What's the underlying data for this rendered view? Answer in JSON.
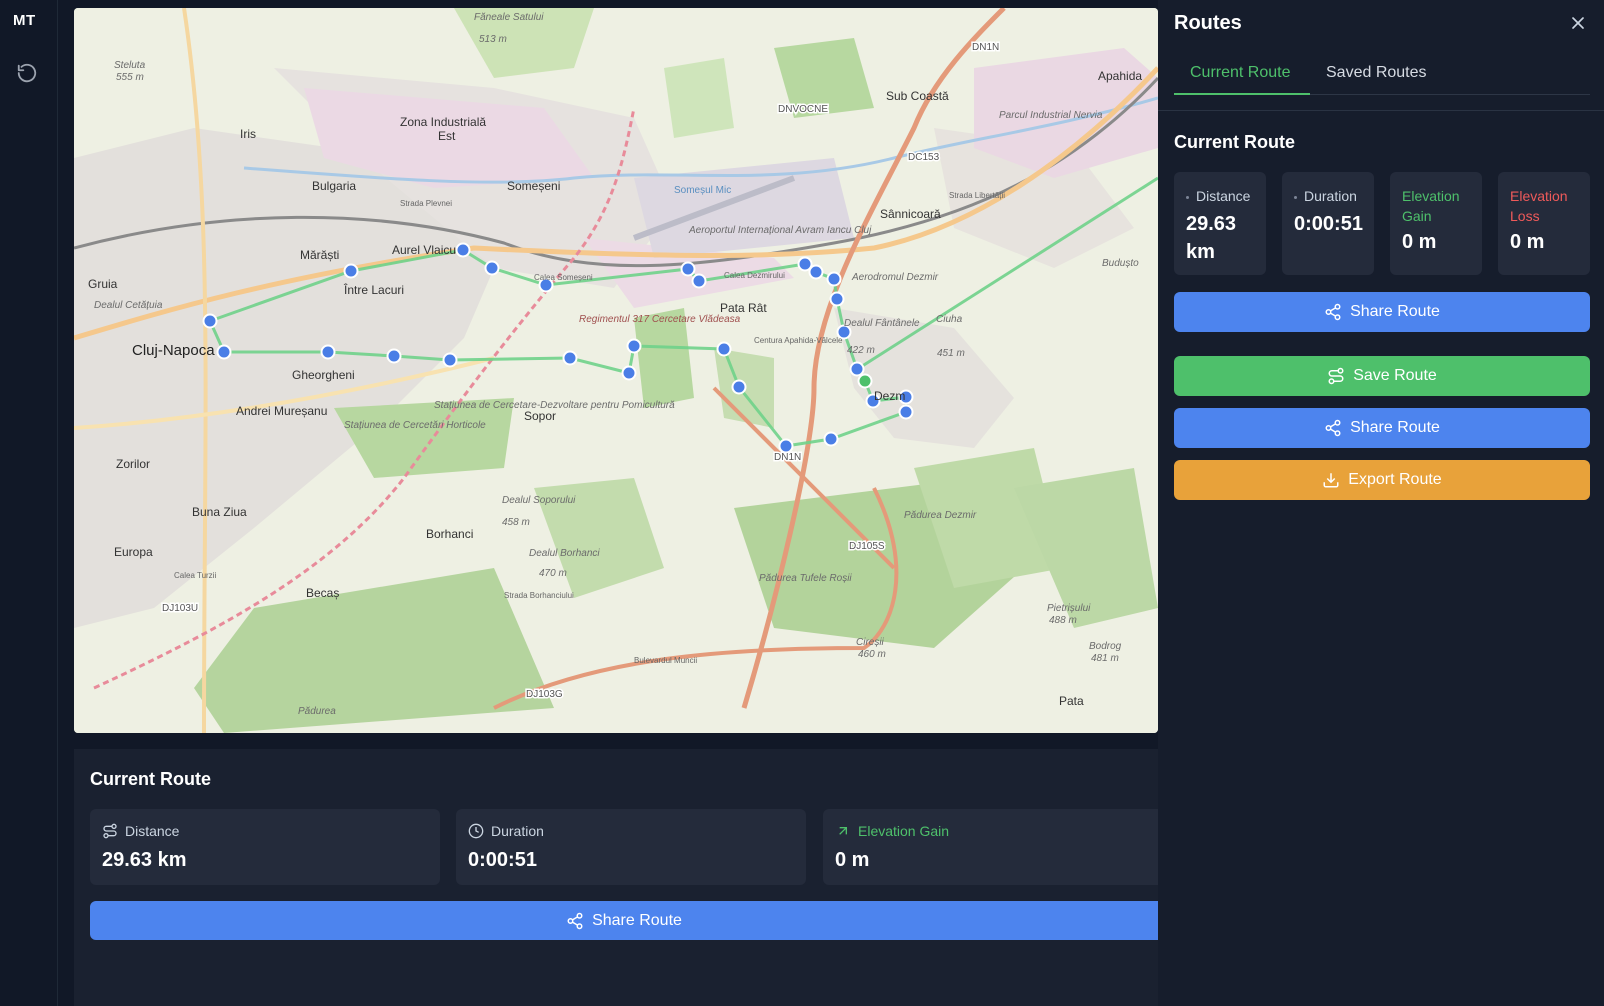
{
  "app": {
    "logo": "MT"
  },
  "icons": {
    "reset": "rotate-ccw-icon",
    "close": "close-icon",
    "share": "share-icon",
    "save": "route-icon",
    "export": "download-icon",
    "distance": "route-icon",
    "duration": "clock-icon",
    "elevation_gain": "trending-up-icon"
  },
  "colors": {
    "accent_green": "#4ec06b",
    "share_blue": "#4d84ee",
    "save_green": "#4ec06b",
    "export_orange": "#e8a23a",
    "loss_red": "#ef5a5a",
    "route_line": "#6fd18a",
    "waypoint": "#4a7ee6"
  },
  "map": {
    "labels": [
      {
        "text": "Făneale Satului",
        "kind": "small"
      },
      {
        "text": "513 m",
        "kind": "small"
      },
      {
        "text": "Steluta",
        "kind": "small"
      },
      {
        "text": "555 m",
        "kind": "small"
      },
      {
        "text": "Zona Industrială",
        "kind": "place"
      },
      {
        "text": "Est",
        "kind": "place"
      },
      {
        "text": "DNVOCNE",
        "kind": "road"
      },
      {
        "text": "Sub Coastă",
        "kind": "place"
      },
      {
        "text": "Parcul Industrial Nervia",
        "kind": "small"
      },
      {
        "text": "DN1N",
        "kind": "road"
      },
      {
        "text": "Apahida",
        "kind": "place"
      },
      {
        "text": "Iris",
        "kind": "place"
      },
      {
        "text": "Bulgaria",
        "kind": "place"
      },
      {
        "text": "Someșeni",
        "kind": "place"
      },
      {
        "text": "Aeroportul Internațional Avram Iancu Cluj",
        "kind": "small"
      },
      {
        "text": "DC153",
        "kind": "road"
      },
      {
        "text": "Sânnicoară",
        "kind": "place"
      },
      {
        "text": "Mărăști",
        "kind": "place"
      },
      {
        "text": "Aurel Vlaicu",
        "kind": "place"
      },
      {
        "text": "Gruia",
        "kind": "place"
      },
      {
        "text": "Între Lacuri",
        "kind": "place"
      },
      {
        "text": "Aerodromul Dezmir",
        "kind": "small"
      },
      {
        "text": "Budușto",
        "kind": "small"
      },
      {
        "text": "Pata Rât",
        "kind": "place"
      },
      {
        "text": "Cluj-Napoca",
        "kind": "city"
      },
      {
        "text": "Regimentul 317 Cercetare Vlădeasa",
        "kind": "military"
      },
      {
        "text": "Dealul Fântânele",
        "kind": "small"
      },
      {
        "text": "422 m",
        "kind": "small"
      },
      {
        "text": "Ciuha",
        "kind": "small"
      },
      {
        "text": "451 m",
        "kind": "small"
      },
      {
        "text": "Gheorgheni",
        "kind": "place"
      },
      {
        "text": "Dealul Cetățuia",
        "kind": "small"
      },
      {
        "text": "Dezm",
        "kind": "place"
      },
      {
        "text": "Andrei Mureșanu",
        "kind": "place"
      },
      {
        "text": "Sopor",
        "kind": "place"
      },
      {
        "text": "Stațiunea de Cercetări Horticole",
        "kind": "small"
      },
      {
        "text": "Stațiunea de Cercetare-Dezvoltare pentru Pomicultură",
        "kind": "small"
      },
      {
        "text": "Zorilor",
        "kind": "place"
      },
      {
        "text": "Dealul Soporului",
        "kind": "small"
      },
      {
        "text": "458 m",
        "kind": "small"
      },
      {
        "text": "Buna Ziua",
        "kind": "place"
      },
      {
        "text": "Borhanci",
        "kind": "place"
      },
      {
        "text": "Pădurea Dezmir",
        "kind": "small"
      },
      {
        "text": "DJ105S",
        "kind": "road"
      },
      {
        "text": "Europa",
        "kind": "place"
      },
      {
        "text": "Dealul Borhanci",
        "kind": "small"
      },
      {
        "text": "470 m",
        "kind": "small"
      },
      {
        "text": "Pădurea Tufele Roșii",
        "kind": "small"
      },
      {
        "text": "Becaș",
        "kind": "place"
      },
      {
        "text": "DJ103U",
        "kind": "road"
      },
      {
        "text": "Pietrișului",
        "kind": "small"
      },
      {
        "text": "488 m",
        "kind": "small"
      },
      {
        "text": "Cireșii",
        "kind": "small"
      },
      {
        "text": "460 m",
        "kind": "small"
      },
      {
        "text": "Bodrog",
        "kind": "small"
      },
      {
        "text": "481 m",
        "kind": "small"
      },
      {
        "text": "DJ103G",
        "kind": "road"
      },
      {
        "text": "Pata",
        "kind": "place"
      },
      {
        "text": "Pădurea",
        "kind": "small"
      },
      {
        "text": "DN1N",
        "kind": "road"
      },
      {
        "text": "Strada Plevnei",
        "kind": "street"
      },
      {
        "text": "Calea Someșeni",
        "kind": "street"
      },
      {
        "text": "Calea Dezmirului",
        "kind": "street"
      },
      {
        "text": "Centura Apahida-Vâlcele",
        "kind": "street"
      },
      {
        "text": "Bulevardul Muncii",
        "kind": "street"
      },
      {
        "text": "Strada Borhanciului",
        "kind": "street"
      },
      {
        "text": "Calea Turzii",
        "kind": "street"
      },
      {
        "text": "Someșul Mic",
        "kind": "water"
      },
      {
        "text": "Strada Libertății",
        "kind": "street"
      }
    ]
  },
  "bottom": {
    "title": "Current Route",
    "distance_label": "Distance",
    "distance_value": "29.63 km",
    "duration_label": "Duration",
    "duration_value": "0:00:51",
    "elevation_gain_label": "Elevation Gain",
    "elevation_gain_value": "0 m",
    "share_label": "Share Route"
  },
  "panel": {
    "title": "Routes",
    "tabs": [
      {
        "label": "Current Route",
        "active": true
      },
      {
        "label": "Saved Routes",
        "active": false
      }
    ],
    "subtitle": "Current Route",
    "stats": {
      "distance_label": "Distance",
      "distance_value": "29.63 km",
      "duration_label": "Duration",
      "duration_value": "0:00:51",
      "gain_label": "Elevation Gain",
      "gain_value": "0 m",
      "loss_label": "Elevation Loss",
      "loss_value": "0 m"
    },
    "buttons": {
      "share_top": "Share Route",
      "save": "Save Route",
      "share": "Share Route",
      "export": "Export Route"
    }
  }
}
